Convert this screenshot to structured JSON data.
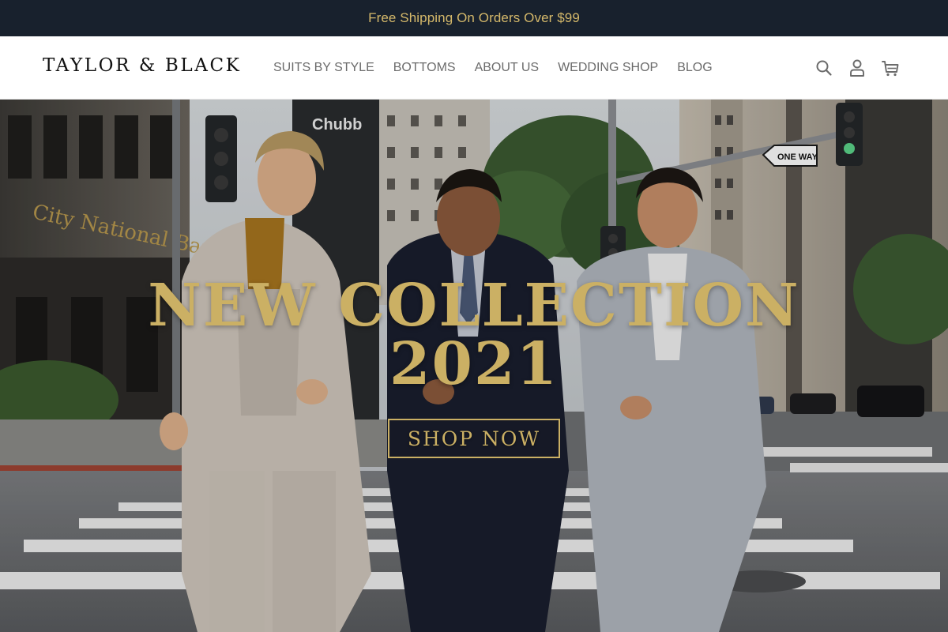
{
  "announcement": {
    "text": "Free Shipping On Orders Over $99"
  },
  "header": {
    "logo": "TAYLOR & BLACK",
    "nav": [
      {
        "label": "SUITS BY STYLE"
      },
      {
        "label": "BOTTOMS"
      },
      {
        "label": "ABOUT US"
      },
      {
        "label": "WEDDING SHOP"
      },
      {
        "label": "BLOG"
      }
    ],
    "icons": [
      "search-icon",
      "account-icon",
      "cart-icon"
    ]
  },
  "hero": {
    "title_line1": "NEW COLLECTION",
    "title_line2": "2021",
    "cta_label": "SHOP NOW",
    "sign_one_way": "ONE WAY",
    "sign_chubb": "Chubb",
    "sign_bank": "City National Bank"
  },
  "colors": {
    "announcement_bg": "#18212d",
    "gold_accent": "#cbb064",
    "nav_text": "#6b6b6b"
  }
}
